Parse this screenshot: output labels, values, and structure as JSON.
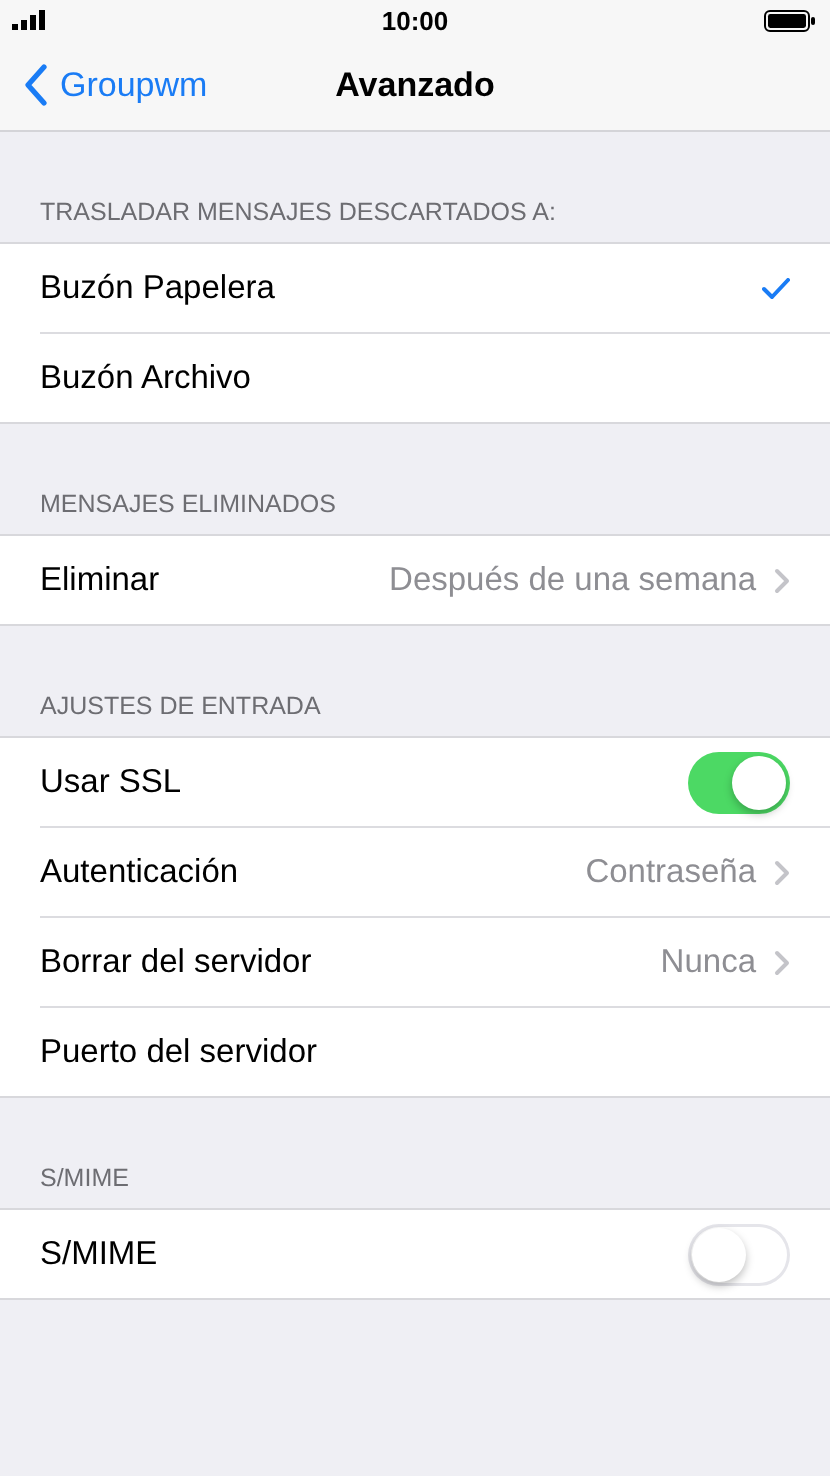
{
  "status_bar": {
    "time": "10:00"
  },
  "nav": {
    "back": "Groupwm",
    "title": "Avanzado"
  },
  "sections": [
    {
      "header": "TRASLADAR MENSAJES DESCARTADOS A:",
      "rows": [
        {
          "kind": "check",
          "label": "Buzón Papelera",
          "selected": true
        },
        {
          "kind": "check",
          "label": "Buzón Archivo",
          "selected": false
        }
      ]
    },
    {
      "header": "MENSAJES ELIMINADOS",
      "rows": [
        {
          "kind": "value",
          "label": "Eliminar",
          "value": "Después de una semana"
        }
      ]
    },
    {
      "header": "AJUSTES DE ENTRADA",
      "rows": [
        {
          "kind": "toggle",
          "label": "Usar SSL",
          "on": true
        },
        {
          "kind": "value",
          "label": "Autenticación",
          "value": "Contraseña"
        },
        {
          "kind": "value",
          "label": "Borrar del servidor",
          "value": "Nunca"
        },
        {
          "kind": "plain",
          "label": "Puerto del servidor"
        }
      ]
    },
    {
      "header": "S/MIME",
      "rows": [
        {
          "kind": "toggle",
          "label": "S/MIME",
          "on": false
        }
      ]
    }
  ]
}
